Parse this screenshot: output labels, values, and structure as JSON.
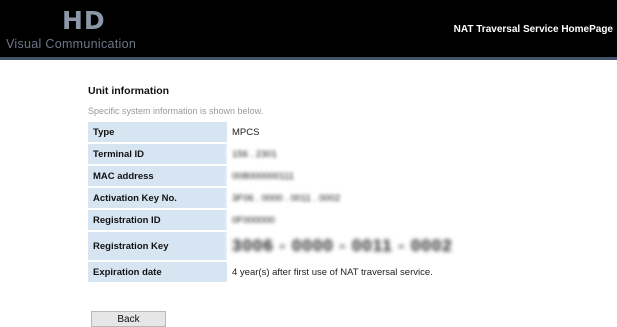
{
  "header": {
    "logo_mark": "HD",
    "logo_sub": "Visual Communication",
    "homepage_link": "NAT Traversal Service HomePage"
  },
  "unit_info": {
    "title": "Unit information",
    "description": "Specific system information is shown below.",
    "rows": [
      {
        "label": "Type",
        "value": "MPCS"
      },
      {
        "label": "Terminal ID",
        "value": "156 . 2301"
      },
      {
        "label": "MAC address",
        "value": "008000000111"
      },
      {
        "label": "Activation Key No.",
        "value": "3F06 . 0000 . 0011 . 0002"
      },
      {
        "label": "Registration ID",
        "value": "0F000000"
      },
      {
        "label": "Registration Key",
        "value": "3006 - 0000 - 0011 - 0002"
      },
      {
        "label": "Expiration date",
        "value": "4 year(s) after first use of NAT traversal service."
      }
    ]
  },
  "buttons": {
    "back": "Back"
  }
}
